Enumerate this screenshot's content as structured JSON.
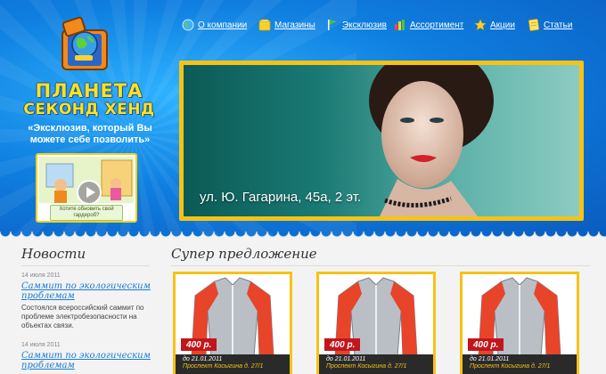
{
  "brand": {
    "name_line1": "ПЛАНЕТА",
    "name_line2": "СЕКОНД ХЕНД",
    "slogan": "«Эксклюзив, который Вы можете себе позволить»"
  },
  "promo": {
    "caption": "Хотите обновить свой гардероб?"
  },
  "nav": [
    {
      "label": "О компании",
      "icon": "globe-icon"
    },
    {
      "label": "Магазины",
      "icon": "shop-icon"
    },
    {
      "label": "Эксклюзив",
      "icon": "flag-icon"
    },
    {
      "label": "Ассортимент",
      "icon": "bars-icon"
    },
    {
      "label": "Акции",
      "icon": "star-icon"
    },
    {
      "label": "Статьи",
      "icon": "notes-icon"
    }
  ],
  "banner": {
    "caption": "ул. Ю. Гагарина, 45а, 2 эт."
  },
  "news": {
    "title": "Новости",
    "items": [
      {
        "date": "14 июля 2011",
        "headline": "Саммит по экологическим проблемам",
        "text": "Состоялся всероссийский саммит по проблеме электробезопасности на объектах связи."
      },
      {
        "date": "14 июля 2011",
        "headline": "Саммит по экологическим проблемам",
        "text": ""
      }
    ]
  },
  "offers": {
    "title": "Супер предложение",
    "items": [
      {
        "price": "400 р.",
        "date": "до 21.01.2011",
        "address": "Проспект Косыгина д. 27/1"
      },
      {
        "price": "400 р.",
        "date": "до 21.01.2011",
        "address": "Проспект Косыгина д. 27/1"
      },
      {
        "price": "400 р.",
        "date": "до 21.01.2011",
        "address": "Проспект Косыгина д. 27/1"
      }
    ]
  },
  "colors": {
    "header_blue": "#0f7fe0",
    "accent_yellow": "#f6c315",
    "price_red": "#c2161b",
    "link_blue": "#1a7bd4"
  }
}
